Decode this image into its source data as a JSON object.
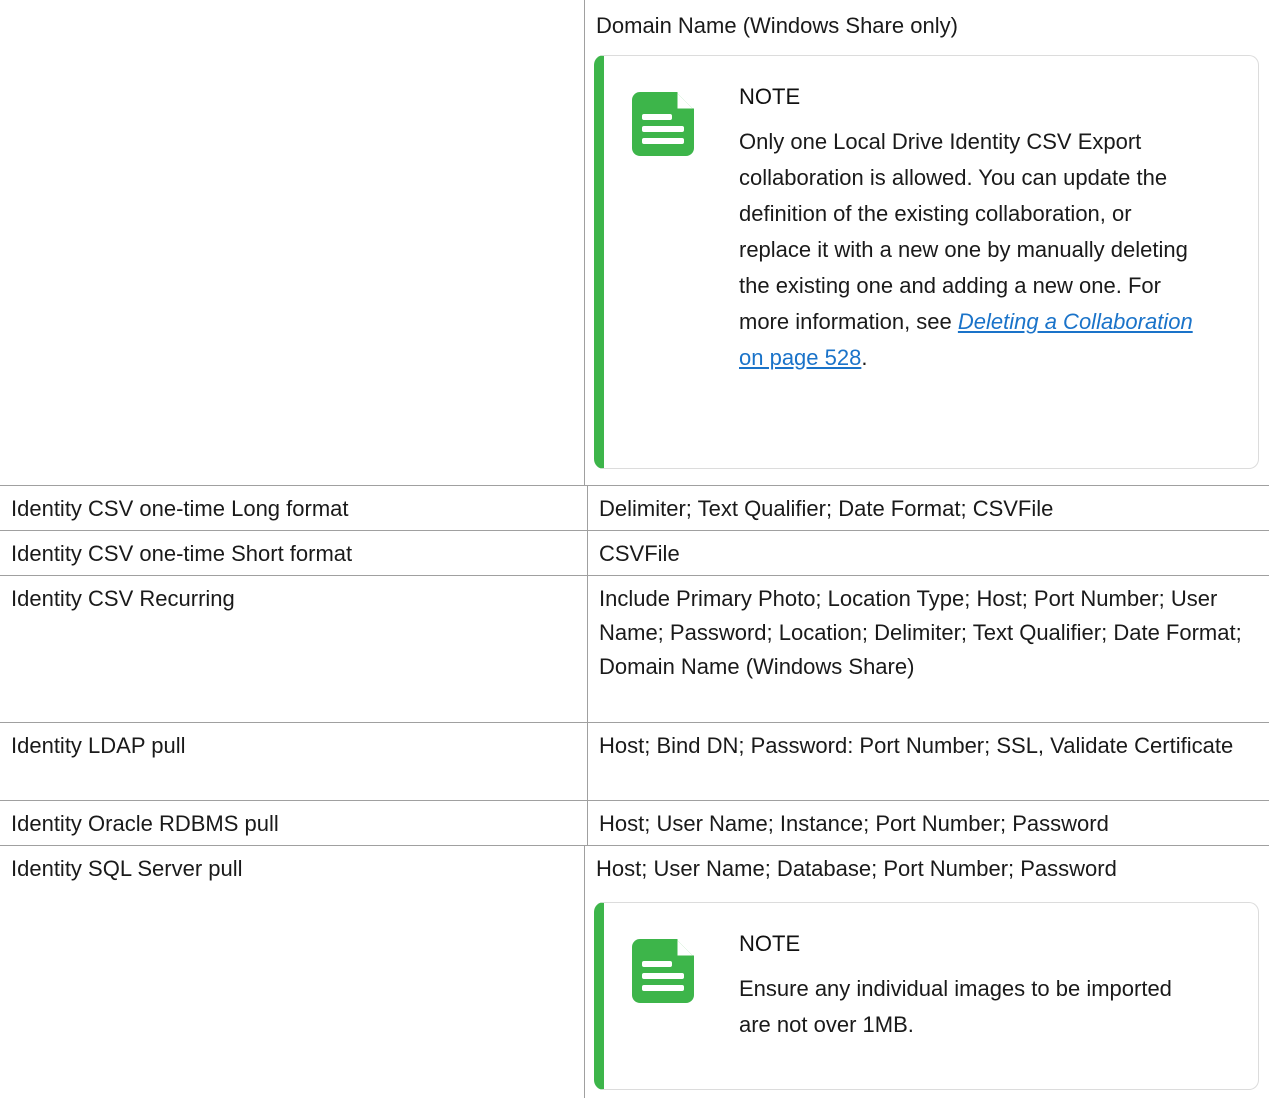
{
  "rows": [
    {
      "left": "",
      "right": "Domain Name (Windows Share only)",
      "note": {
        "title": "NOTE",
        "text": "Only one Local Drive Identity CSV Export collaboration is allowed. You can update the definition of the existing collaboration, or replace it with a new one by manually deleting the existing one and adding a new one. For more information, see ",
        "link_italic": "Deleting a Collaboration",
        "link_plain": " on page 528",
        "trail": "."
      }
    },
    {
      "left": "Identity CSV one-time Long format",
      "right": "Delimiter; Text Qualifier; Date Format; CSVFile"
    },
    {
      "left": "Identity CSV one-time Short format",
      "right": "CSVFile"
    },
    {
      "left": "Identity CSV Recurring",
      "right": "Include Primary Photo; Location Type; Host; Port Number; User Name; Password; Location; Delimiter; Text Qualifier; Date Format; Domain Name (Windows Share)"
    },
    {
      "left": "Identity LDAP pull",
      "right": "Host; Bind DN; Password: Port Number; SSL, Validate Certificate"
    },
    {
      "left": "Identity Oracle RDBMS pull",
      "right": "Host; User Name; Instance; Port Number; Password"
    },
    {
      "left": "Identity SQL Server pull",
      "right": "Host; User Name; Database; Port Number; Password",
      "note": {
        "title": "NOTE",
        "text": "Ensure any individual images to be imported are not over 1MB."
      }
    }
  ],
  "icons": {
    "note": "document-note-icon"
  },
  "colors": {
    "accent": "#3db54a",
    "link": "#1a73c9",
    "border": "#a0a0a0"
  }
}
